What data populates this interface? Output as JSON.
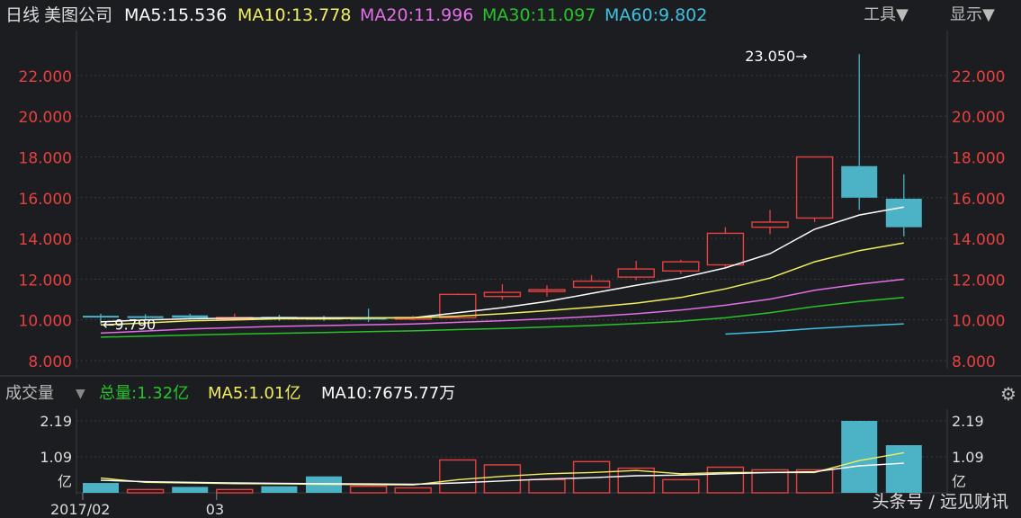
{
  "header": {
    "period": "日线",
    "stock_name": "美图公司",
    "ma5": "MA5:15.536",
    "ma10": "MA10:13.778",
    "ma20": "MA20:11.996",
    "ma30": "MA30:11.097",
    "ma60": "MA60:9.802",
    "tools_menu": "工具▼",
    "display_menu": "显示▼"
  },
  "volume_header": {
    "title": "成交量",
    "total": "总量:1.32亿",
    "ma5": "MA5:1.01亿",
    "ma10": "MA10:7675.77万"
  },
  "watermark": "头条号 / 远见财讯",
  "colors": {
    "up": "#e8403f",
    "down": "#4cb3c7",
    "ma5": "#ffffff",
    "ma10": "#f2ee5c",
    "ma20": "#e46ee6",
    "ma30": "#27c32b",
    "ma60": "#3ec0e0",
    "axis_label": "#e8403f",
    "grid": "#3a3c44"
  },
  "chart_data": [
    {
      "type": "candlestick",
      "y_ticks": [
        "22.000",
        "20.000",
        "18.000",
        "16.000",
        "14.000",
        "12.000",
        "10.000",
        "8.000"
      ],
      "ylim": [
        7.6,
        23.5
      ],
      "annotations": [
        {
          "text": "23.050→",
          "value": 23.05,
          "candle": 16
        },
        {
          "text": "←9.790",
          "value": 9.79,
          "candle": 0
        }
      ],
      "candles": [
        {
          "open": 10.2,
          "close": 10.15,
          "high": 10.3,
          "low": 9.79
        },
        {
          "open": 10.18,
          "close": 10.12,
          "high": 10.28,
          "low": 10.0
        },
        {
          "open": 10.22,
          "close": 10.1,
          "high": 10.3,
          "low": 10.02
        },
        {
          "open": 10.05,
          "close": 10.12,
          "high": 10.3,
          "low": 10.0
        },
        {
          "open": 10.15,
          "close": 10.05,
          "high": 10.25,
          "low": 9.95
        },
        {
          "open": 10.1,
          "close": 10.08,
          "high": 10.2,
          "low": 9.95
        },
        {
          "open": 10.1,
          "close": 10.05,
          "high": 10.55,
          "low": 9.9
        },
        {
          "open": 10.05,
          "close": 10.12,
          "high": 10.2,
          "low": 9.98
        },
        {
          "open": 10.1,
          "close": 11.25,
          "high": 11.3,
          "low": 10.05
        },
        {
          "open": 11.15,
          "close": 11.35,
          "high": 11.75,
          "low": 11.0
        },
        {
          "open": 11.4,
          "close": 11.48,
          "high": 11.7,
          "low": 11.15
        },
        {
          "open": 11.6,
          "close": 11.9,
          "high": 12.2,
          "low": 11.55
        },
        {
          "open": 12.1,
          "close": 12.5,
          "high": 12.9,
          "low": 11.95
        },
        {
          "open": 12.4,
          "close": 12.85,
          "high": 12.95,
          "low": 12.25
        },
        {
          "open": 12.7,
          "close": 14.25,
          "high": 14.55,
          "low": 12.6
        },
        {
          "open": 14.55,
          "close": 14.8,
          "high": 15.4,
          "low": 14.2
        },
        {
          "open": 15.0,
          "close": 18.0,
          "high": 18.0,
          "low": 14.8
        },
        {
          "open": 17.55,
          "close": 16.0,
          "high": 23.05,
          "low": 15.4
        },
        {
          "open": 15.95,
          "close": 14.55,
          "high": 17.15,
          "low": 14.1
        }
      ],
      "ma_lines": [
        {
          "name": "MA5",
          "color_key": "ma5",
          "values": [
            9.9,
            10.0,
            10.05,
            10.08,
            10.1,
            10.1,
            10.1,
            10.1,
            10.35,
            10.6,
            10.9,
            11.3,
            11.7,
            12.05,
            12.55,
            13.25,
            14.45,
            15.15,
            15.536
          ]
        },
        {
          "name": "MA10",
          "color_key": "ma10",
          "values": [
            9.75,
            9.85,
            9.95,
            10.0,
            10.05,
            10.05,
            10.08,
            10.1,
            10.18,
            10.3,
            10.45,
            10.62,
            10.82,
            11.1,
            11.52,
            12.05,
            12.85,
            13.4,
            13.778
          ]
        },
        {
          "name": "MA20",
          "color_key": "ma20",
          "values": [
            9.35,
            9.45,
            9.55,
            9.62,
            9.68,
            9.72,
            9.76,
            9.8,
            9.88,
            9.96,
            10.05,
            10.16,
            10.3,
            10.48,
            10.72,
            11.02,
            11.45,
            11.75,
            11.996
          ]
        },
        {
          "name": "MA30",
          "color_key": "ma30",
          "values": [
            9.15,
            9.2,
            9.25,
            9.3,
            9.34,
            9.38,
            9.42,
            9.46,
            9.52,
            9.58,
            9.65,
            9.72,
            9.82,
            9.93,
            10.1,
            10.35,
            10.65,
            10.9,
            11.097
          ]
        },
        {
          "name": "MA60",
          "color_key": "ma60",
          "values": [
            null,
            null,
            null,
            null,
            null,
            null,
            null,
            null,
            null,
            null,
            null,
            null,
            null,
            null,
            9.3,
            9.42,
            9.58,
            9.7,
            9.802
          ]
        }
      ]
    },
    {
      "type": "bar",
      "unit": "亿",
      "y_ticks": [
        "2.19",
        "1.09"
      ],
      "ylim": [
        0,
        2.19
      ],
      "x_ticks": [
        {
          "label": "2017/02",
          "index": 0
        },
        {
          "label": "03",
          "index": 3
        }
      ],
      "volumes": [
        0.3,
        0.1,
        0.18,
        0.1,
        0.2,
        0.5,
        0.2,
        0.15,
        1.0,
        0.85,
        0.4,
        0.95,
        0.75,
        0.4,
        0.78,
        0.7,
        0.7,
        2.19,
        1.45
      ],
      "directions": [
        "down",
        "up",
        "down",
        "up",
        "down",
        "down",
        "up",
        "up",
        "up",
        "up",
        "up",
        "up",
        "up",
        "up",
        "up",
        "up",
        "up",
        "down",
        "down"
      ],
      "ma5": [
        0.45,
        0.32,
        0.3,
        0.28,
        0.27,
        0.26,
        0.25,
        0.24,
        0.4,
        0.5,
        0.58,
        0.62,
        0.68,
        0.58,
        0.62,
        0.62,
        0.62,
        0.98,
        1.22
      ],
      "ma10": [
        0.38,
        0.34,
        0.32,
        0.3,
        0.29,
        0.28,
        0.27,
        0.26,
        0.3,
        0.36,
        0.42,
        0.46,
        0.52,
        0.54,
        0.58,
        0.62,
        0.64,
        0.82,
        0.9
      ]
    }
  ]
}
